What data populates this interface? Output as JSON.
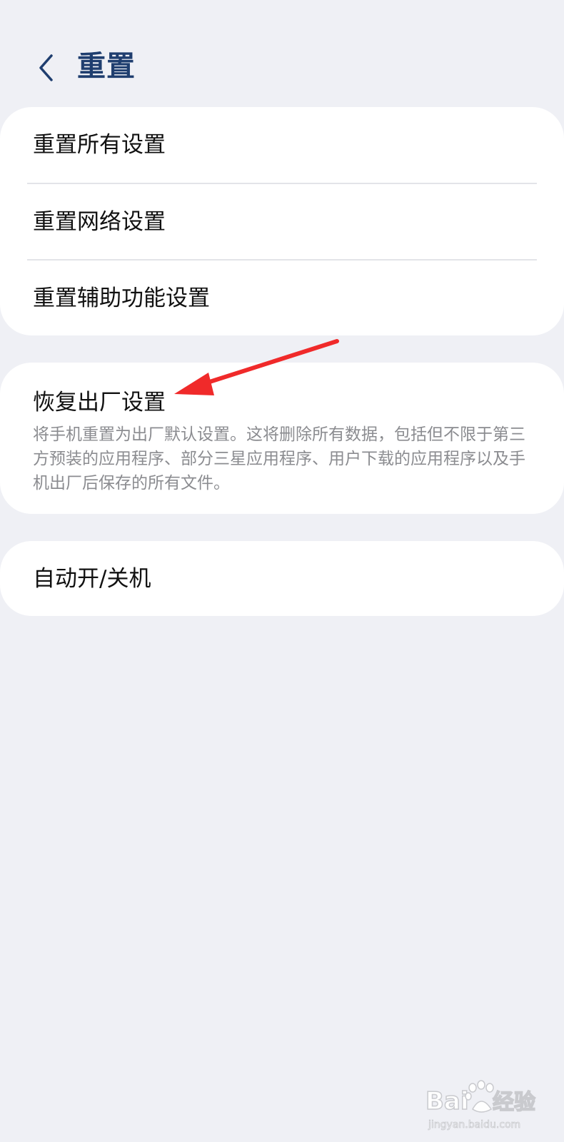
{
  "header": {
    "back_icon": "chevron-left-icon",
    "title": "重置"
  },
  "reset_options": [
    {
      "label": "重置所有设置"
    },
    {
      "label": "重置网络设置"
    },
    {
      "label": "重置辅助功能设置"
    }
  ],
  "factory_reset": {
    "title": "恢复出厂设置",
    "description": "将手机重置为出厂默认设置。这将删除所有数据，包括但不限于第三方预装的应用程序、部分三星应用程序、用户下载的应用程序以及手机出厂后保存的所有文件。"
  },
  "auto_power": {
    "label": "自动开/关机"
  },
  "annotation": {
    "arrow_color": "#f02a2a"
  },
  "watermark": {
    "logo_text": "Baidu经验",
    "url_text": "jingyan.baidu.com"
  },
  "colors": {
    "background": "#eff0f5",
    "card": "#ffffff",
    "title": "#1f3e6f",
    "secondary_text": "#8b8c90"
  }
}
